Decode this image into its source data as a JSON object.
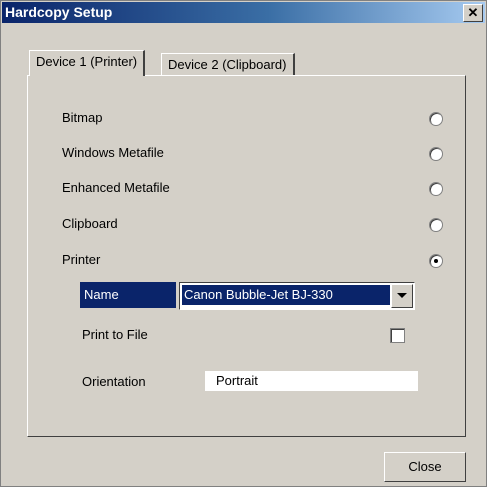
{
  "window": {
    "title": "Hardcopy Setup",
    "close_glyph": "✕"
  },
  "tabs": [
    {
      "label": "Device 1 (Printer)",
      "active": true
    },
    {
      "label": "Device 2 (Clipboard)",
      "active": false
    }
  ],
  "options": [
    {
      "label": "Bitmap",
      "selected": false
    },
    {
      "label": "Windows Metafile",
      "selected": false
    },
    {
      "label": "Enhanced Metafile",
      "selected": false
    },
    {
      "label": "Clipboard",
      "selected": false
    },
    {
      "label": "Printer",
      "selected": true
    }
  ],
  "printer": {
    "name_label": "Name",
    "name_value": "Canon Bubble-Jet BJ-330",
    "print_to_file_label": "Print to File",
    "print_to_file_checked": false,
    "orientation_label": "Orientation",
    "orientation_value": "Portrait"
  },
  "footer": {
    "close_label": "Close"
  },
  "colors": {
    "title_bar": "#0a246a",
    "face": "#d4d0c8",
    "selection": "#0a246a"
  }
}
